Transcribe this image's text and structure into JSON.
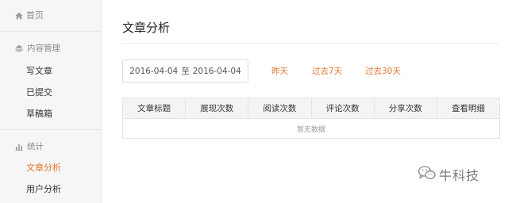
{
  "sidebar": {
    "home": {
      "label": "首页",
      "icon": "home-icon"
    },
    "content_section": {
      "title": "内容管理",
      "icon": "layers-icon",
      "items": [
        {
          "label": "写文章"
        },
        {
          "label": "已提交"
        },
        {
          "label": "草稿箱"
        }
      ]
    },
    "stats_section": {
      "title": "统计",
      "icon": "bar-chart-icon",
      "items": [
        {
          "label": "文章分析",
          "active": true
        },
        {
          "label": "用户分析"
        }
      ]
    }
  },
  "main": {
    "title": "文章分析",
    "date_range": {
      "start": "2016-04-04",
      "separator": "至",
      "end": "2016-04-04"
    },
    "quick_ranges": [
      "昨天",
      "过去7天",
      "过去30天"
    ],
    "table": {
      "columns": [
        "文章标题",
        "展现次数",
        "阅读次数",
        "评论次数",
        "分享次数",
        "查看明细"
      ],
      "empty_text": "暂无数据"
    }
  },
  "watermark": {
    "text": "牛科技",
    "icon": "wechat-icon"
  },
  "colors": {
    "accent": "#e8762d",
    "sidebar_bg": "#f6f6f6",
    "header_bg": "#f4f4f4",
    "border": "#e4e4e4"
  }
}
